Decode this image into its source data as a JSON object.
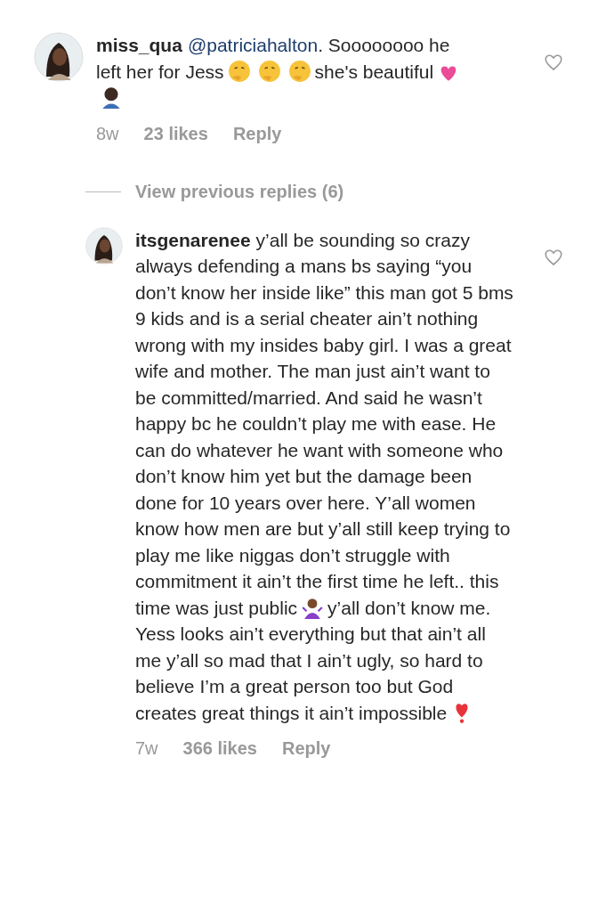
{
  "comments": [
    {
      "username": "miss_qua",
      "parts": [
        {
          "kind": "mention",
          "text": "@patriciahalton"
        },
        {
          "kind": "text",
          "text": ". Soooooooo he left her for Jess"
        },
        {
          "kind": "thinking"
        },
        {
          "kind": "thinking"
        },
        {
          "kind": "thinking"
        },
        {
          "kind": "text",
          "text": "she's beautiful"
        },
        {
          "kind": "heart"
        },
        {
          "kind": "facepalm"
        }
      ],
      "time": "8w",
      "likes": "23 likes",
      "reply": "Reply",
      "liked": false
    },
    {
      "username": "itsgenarenee",
      "parts": [
        {
          "kind": "text",
          "text": "y’all be sounding so crazy always defending a mans bs saying “you don’t know her inside like” this man got 5 bms 9 kids and is a serial cheater ain’t nothing wrong with my insides baby girl. I was a great wife and mother. The man just ain’t want to be committed/married. And said he wasn’t happy bc he couldn’t play me with ease. He can do whatever he want with someone who don’t know him yet but the damage been done for 10 years over here. Y’all women know how men are but y’all still keep trying to play me like niggas don’t struggle with commitment it ain’t the first time he left.. this time was just public"
        },
        {
          "kind": "shrug"
        },
        {
          "kind": "text",
          "text": "y’all don’t know me. Yess looks ain’t everything but that ain’t all me y’all so mad that I ain’t ugly, so hard to believe I’m a great person too but God creates great things it ain’t impossible"
        },
        {
          "kind": "exclaim"
        }
      ],
      "time": "7w",
      "likes": "366 likes",
      "reply": "Reply",
      "liked": false,
      "view_previous": "View previous replies (6)"
    }
  ]
}
